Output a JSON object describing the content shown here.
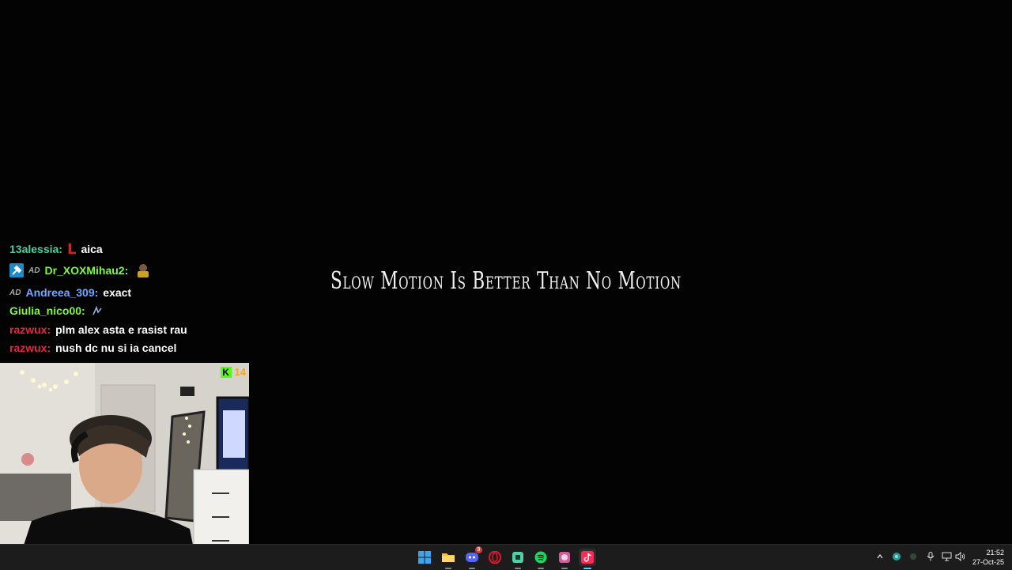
{
  "wallpaper": {
    "quote": "Slow Motion Is Better Than No Motion"
  },
  "chat": {
    "messages": [
      {
        "user": "13alessia:",
        "color": "#3fd6a6",
        "message": "aica",
        "emote": "red-L-emote"
      },
      {
        "user": "Dr_XOXMihau2:",
        "color": "#7cfc3a",
        "message": "",
        "badges": [
          "moderator-badge",
          "ad-badge"
        ],
        "emote": "character-emote"
      },
      {
        "user": "Andreea_309:",
        "color": "#6fa8ff",
        "message": "exact",
        "badges": [
          "ad-badge"
        ]
      },
      {
        "user": "Giulia_nico00:",
        "color": "#7cfc3a",
        "message": "",
        "emote": "sticker-emote"
      },
      {
        "user": "razwux:",
        "color": "#e5263c",
        "message": "plm alex asta e rasist rau"
      },
      {
        "user": "razwux:",
        "color": "#e5263c",
        "message": "nush dc nu si ia cancel"
      }
    ],
    "ad_badge_text": "AD"
  },
  "stream": {
    "platform_logo": "K",
    "viewer_count": "14",
    "platform_color": "#53fc18"
  },
  "taskbar": {
    "apps": [
      {
        "name": "start",
        "icon": "windows-icon"
      },
      {
        "name": "file-explorer",
        "icon": "folder-icon"
      },
      {
        "name": "discord",
        "icon": "discord-icon",
        "badge": "9"
      },
      {
        "name": "opera",
        "icon": "opera-icon"
      },
      {
        "name": "app-green",
        "icon": "store-icon"
      },
      {
        "name": "spotify",
        "icon": "spotify-icon"
      },
      {
        "name": "app-pink",
        "icon": "game-icon"
      },
      {
        "name": "tiktok",
        "icon": "tiktok-icon",
        "active": true
      }
    ],
    "clock": {
      "time": "21:52",
      "date": "27-Oct-25"
    }
  }
}
